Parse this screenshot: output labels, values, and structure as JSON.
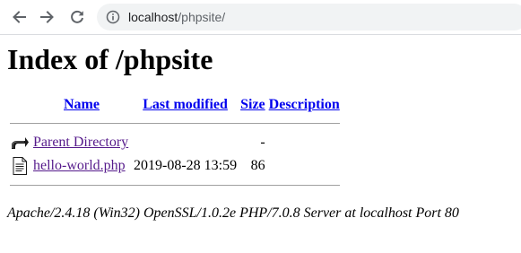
{
  "browser": {
    "url_host": "localhost",
    "url_path": "/phpsite/"
  },
  "page": {
    "title": "Index of /phpsite",
    "columns": {
      "name": "Name",
      "last_modified": "Last modified",
      "size": "Size",
      "description": "Description"
    },
    "rows": [
      {
        "icon": "parent-directory-icon",
        "name": "Parent Directory",
        "last_modified": "",
        "size": "-",
        "description": ""
      },
      {
        "icon": "text-file-icon",
        "name": "hello-world.php",
        "last_modified": "2019-08-28 13:59",
        "size": "86",
        "description": ""
      }
    ],
    "footer": "Apache/2.4.18 (Win32) OpenSSL/1.0.2e PHP/7.0.8 Server at localhost Port 80"
  },
  "colors": {
    "link": "#0000ee",
    "visited_link": "#551a8b",
    "omnibox_bg": "#f1f3f4",
    "rule": "#a0a0a0"
  }
}
